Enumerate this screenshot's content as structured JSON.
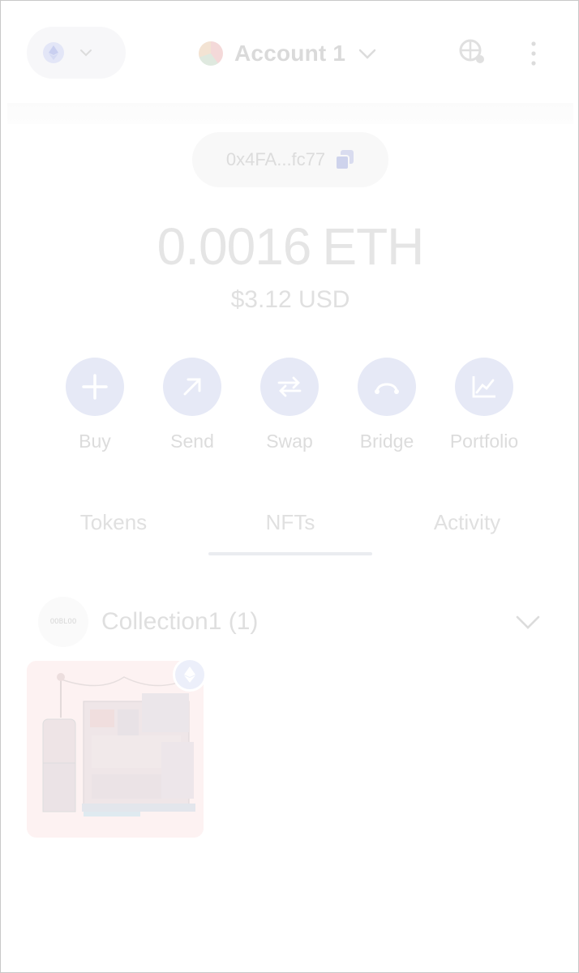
{
  "header": {
    "account_name": "Account 1"
  },
  "address": {
    "short": "0x4FA...fc77"
  },
  "balance": {
    "amount": "0.0016",
    "symbol": "ETH",
    "fiat": "$3.12 USD"
  },
  "actions": [
    {
      "label": "Buy",
      "icon": "plus-icon"
    },
    {
      "label": "Send",
      "icon": "arrow-up-right-icon"
    },
    {
      "label": "Swap",
      "icon": "swap-arrows-icon"
    },
    {
      "label": "Bridge",
      "icon": "bridge-icon"
    },
    {
      "label": "Portfolio",
      "icon": "chart-icon"
    }
  ],
  "tabs": [
    {
      "label": "Tokens",
      "active": false
    },
    {
      "label": "NFTs",
      "active": true
    },
    {
      "label": "Activity",
      "active": false
    }
  ],
  "collection": {
    "name": "Collection1 (1)",
    "thumb_text": "OOBLOO"
  },
  "colors": {
    "action_circle": "#e6e9f6",
    "faded_text": "#dcdcdc"
  }
}
